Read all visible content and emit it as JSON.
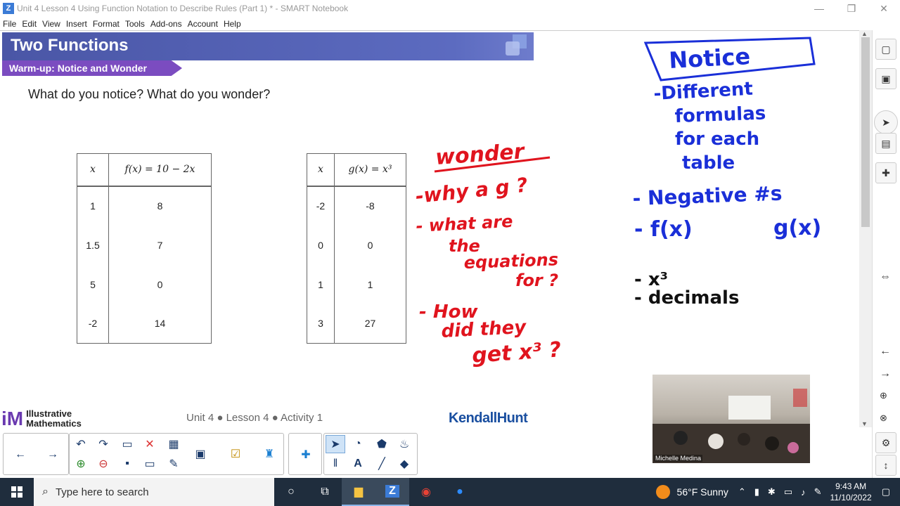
{
  "window": {
    "title": "Unit 4 Lesson 4 Using Function Notation to Describe Rules (Part 1) * - SMART Notebook",
    "controls": [
      "—",
      "❐",
      "✕"
    ]
  },
  "menu": [
    "File",
    "Edit",
    "View",
    "Insert",
    "Format",
    "Tools",
    "Add-ons",
    "Account",
    "Help"
  ],
  "slide": {
    "title": "Two Functions",
    "subtitle": "Warm-up: Notice and Wonder",
    "prompt": "What do you notice? What do you wonder?",
    "table_f": {
      "headers": [
        "x",
        "f(x) = 10 − 2x"
      ],
      "rows": [
        [
          "1",
          "8"
        ],
        [
          "1.5",
          "7"
        ],
        [
          "5",
          "0"
        ],
        [
          "-2",
          "14"
        ]
      ]
    },
    "table_g": {
      "headers": [
        "x",
        "g(x) = x³"
      ],
      "rows": [
        [
          "-2",
          "-8"
        ],
        [
          "0",
          "0"
        ],
        [
          "1",
          "1"
        ],
        [
          "3",
          "27"
        ]
      ]
    },
    "footer": {
      "logo_mark": "iM",
      "logo_line1": "Illustrative",
      "logo_line2": "Mathematics",
      "center": "Unit 4 ● Lesson 4 ● Activity 1",
      "right": "KendallHunt"
    }
  },
  "ink": {
    "wonder_title": "wonder",
    "wonder_items": [
      "-why a g ?",
      "- what are",
      "the",
      "equations",
      "for ?",
      "- How",
      "did they",
      "get x³ ?"
    ],
    "notice_title": "Notice",
    "notice_items": [
      "-Different",
      "formulas",
      "for each",
      "table",
      "- Negative #s",
      "- f(x)",
      "g(x)",
      "- x³",
      "- decimals"
    ]
  },
  "video": {
    "name": "Michelle Medina"
  },
  "taskbar": {
    "search_placeholder": "Type here to search",
    "weather": "56°F  Sunny",
    "time": "9:43 AM",
    "date": "11/10/2022"
  },
  "colors": {
    "header_blue": "#4a56a6",
    "subtitle_purple": "#7b4cc0",
    "ink_red": "#e0141e",
    "ink_blue": "#1a2fd8",
    "ink_black": "#111111",
    "taskbar": "#1f2d3d"
  }
}
